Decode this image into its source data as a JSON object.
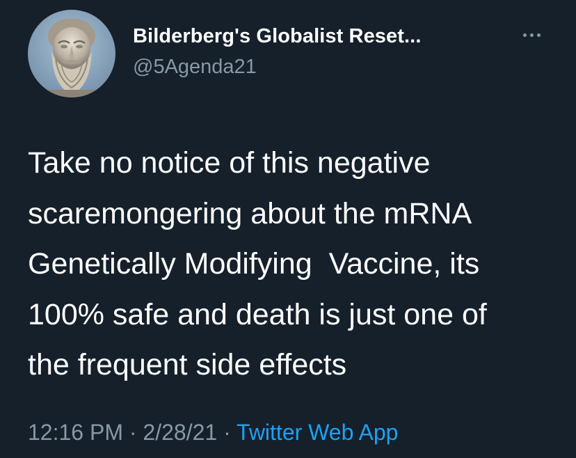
{
  "tweet": {
    "display_name": "Bilderberg's Globalist Reset...",
    "handle": "@5Agenda21",
    "text_lines": [
      "Take no notice of this negative",
      "scaremongering about the mRNA",
      "Genetically Modifying  Vaccine, its",
      "100% safe and death is just one of",
      "the frequent side effects"
    ],
    "time": "12:16 PM",
    "separator": " · ",
    "date": "2/28/21",
    "source": "Twitter Web App"
  },
  "icons": {
    "more": "more-horizontal-icon",
    "avatar": "bust-statue-avatar"
  },
  "colors": {
    "background": "#15202b",
    "primary_text": "#ffffff",
    "secondary_text": "#8899a6",
    "link": "#1da1f2"
  }
}
